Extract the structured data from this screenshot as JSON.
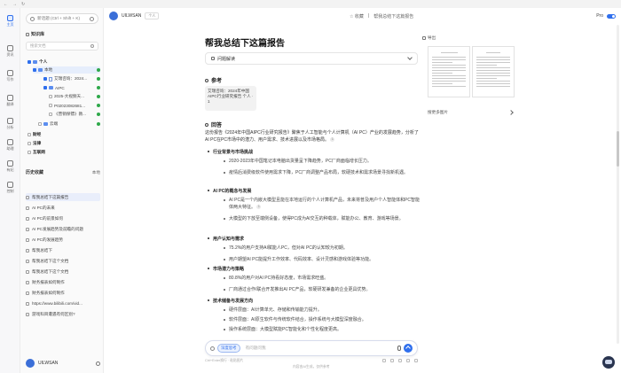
{
  "rail": [
    {
      "label": "主页",
      "icon": "home-icon",
      "active": true
    },
    {
      "label": "资讯",
      "icon": "news-icon"
    },
    {
      "label": "写作",
      "icon": "pen-icon"
    },
    {
      "label": "翻译",
      "icon": "translate-icon"
    },
    {
      "label": "分析",
      "icon": "analysis-icon"
    },
    {
      "label": "助理",
      "icon": "assistant-icon"
    },
    {
      "label": "有纪",
      "icon": "record-icon"
    },
    {
      "label": "控制",
      "icon": "control-icon"
    }
  ],
  "sidebar": {
    "new_chat": "新话题 (Ctrl + Shift + K)",
    "kb_title": "知识库",
    "search_placeholder": "搜索文档",
    "tree": {
      "personal": "个人",
      "local": "本地",
      "doc1": "艾瑞咨询：2024...",
      "aipc": "AIPC",
      "doc2": "2025-大视频天...",
      "doc3": "P02023082681...",
      "doc4": "《营销保镖》教...",
      "cloud": "云端",
      "finance": "财经",
      "law": "法律",
      "internet": "互联网"
    },
    "history_title": "历史收藏",
    "history_filter": "本地",
    "history": [
      "帮我总结下这篇报告",
      "AI PC的未来",
      "AI PC的前景如何",
      "AI PC发展趋势及前瞻的问题",
      "AI PC的发展趋势",
      "帮我总结下",
      "帮我总结下这个文档",
      "帮我总结下这个文档",
      "财务报表如何制作",
      "财务报表如何制作",
      "https://www.bilibili.com/vid...",
      "游戏科目遭遇有何区别?"
    ],
    "user": "UILWSAN"
  },
  "header": {
    "user": "UILWSAN",
    "tag": "个人",
    "collect": "收藏",
    "title": "帮我总结下这篇报告",
    "pro": "Pro"
  },
  "main": {
    "question": "帮我总结下这篇报告",
    "analysis": "问题解读",
    "ref_title": "参考",
    "ref_card": "艾瑞咨询：2024年中国AIPC行业研究报告 个人 · 1",
    "answer_title": "回答",
    "intro": "这份报告《2024年中国AIPC行业研究报告》聚焦于人工智能与个人计算机（AI PC）产业的发展趋势，分析了AI PC在PC市场中的潜力、用户需求、技术进展以及市场格局。",
    "sections": [
      {
        "heading": "行业背景与市场挑战",
        "bullets": [
          "2020-2023年中国笔记本电脑出货量呈下降趋势，PC厂商面临增长压力。",
          "疫情后消费级软件使用需求下降，PC厂商调整产品布局，软硬技术和需求场景寻找新机遇。"
        ]
      },
      {
        "heading": "AI PC的概念与发展",
        "bullets": [
          "AI PC是一个内嵌大模型且能在本地运行的个人计算机产品，未来将普及用户个人智能体和PC智能体两大特征。",
          "大模型的下放至端侧设备，使得PC成为AI交互的种载体，赋能办公、教育、游戏等场景。"
        ]
      },
      {
        "heading": "用户认知与需求",
        "bullets": [
          "75.2%的用户支持AI赋能人PC，但对AI PC的认知较为初期。",
          "用户期望AI PC能提升工作效率、代码效率、设计灵感和游戏体验等功能。"
        ]
      },
      {
        "heading": "市场潜力与策略",
        "bullets": [
          "80.8%的用户对AI PC持看好态度，市场需求旺盛。",
          "厂商通过合作/联合开发推出AI PC产品，软硬研发兼备的企业更具优势。"
        ]
      },
      {
        "heading": "技术储备与发展方向",
        "bullets": [
          "硬件层面：AI计算单元、存储和传输能力提升。",
          "软件层面：AI原生软件与传统软件结合，操作系统与大模型深度融合。",
          "操作系统层面：大模型赋能PC智能化和个性化程度更高。"
        ]
      }
    ],
    "composer": {
      "deep": "深度思考",
      "placeholder": "有问题问我",
      "foot_left": "Ctrl+Enter换行 · 粘贴图片",
      "disclaimer": "内容由AI生成，仅供参考"
    }
  },
  "right_panel": {
    "export": "导出",
    "more_images": "搜更多图片"
  },
  "colors": {
    "accent": "#2f6fed",
    "green_dot": "#2ea84a"
  }
}
